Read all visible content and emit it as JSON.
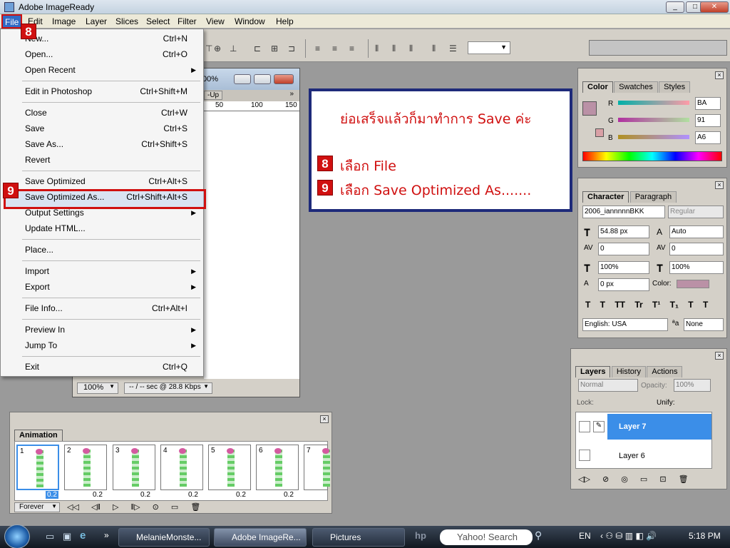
{
  "app_title": "Adobe ImageReady",
  "window_buttons": [
    "_",
    "□",
    "✕"
  ],
  "menubar": [
    "File",
    "Edit",
    "Image",
    "Layer",
    "Slices",
    "Select",
    "Filter",
    "View",
    "Window",
    "Help"
  ],
  "file_menu": {
    "new": {
      "label": "New...",
      "shortcut": "Ctrl+N"
    },
    "open": {
      "label": "Open...",
      "shortcut": "Ctrl+O"
    },
    "open_recent": {
      "label": "Open Recent"
    },
    "edit_photoshop": {
      "label": "Edit in Photoshop",
      "shortcut": "Ctrl+Shift+M"
    },
    "close": {
      "label": "Close",
      "shortcut": "Ctrl+W"
    },
    "save": {
      "label": "Save",
      "shortcut": "Ctrl+S"
    },
    "save_as": {
      "label": "Save As...",
      "shortcut": "Ctrl+Shift+S"
    },
    "revert": {
      "label": "Revert"
    },
    "save_optimized": {
      "label": "Save Optimized",
      "shortcut": "Ctrl+Alt+S"
    },
    "save_optimized_as": {
      "label": "Save Optimized As...",
      "shortcut": "Ctrl+Shift+Alt+S"
    },
    "output_settings": {
      "label": "Output Settings"
    },
    "update_html": {
      "label": "Update HTML..."
    },
    "place": {
      "label": "Place..."
    },
    "import": {
      "label": "Import"
    },
    "export": {
      "label": "Export"
    },
    "file_info": {
      "label": "File Info...",
      "shortcut": "Ctrl+Alt+I"
    },
    "preview_in": {
      "label": "Preview In"
    },
    "jump_to": {
      "label": "Jump To"
    },
    "exit": {
      "label": "Exit",
      "shortcut": "Ctrl+Q"
    }
  },
  "badges": {
    "step8": "8",
    "step9": "9"
  },
  "instruction": {
    "line1": "ย่อเสร็จแล้วก็มาทำการ  Save  ค่ะ",
    "line2": "เลือก  File",
    "line3": "เลือก  Save  Optimized  As......."
  },
  "document": {
    "title_fragment": "00%",
    "tab_fragment": "-Up",
    "ruler": [
      "50",
      "100",
      "150"
    ],
    "zoom": "100%",
    "status": "-- / -- sec @ 28.8 Kbps"
  },
  "color_panel": {
    "tabs": [
      "Color",
      "Swatches",
      "Styles"
    ],
    "channels": [
      {
        "name": "R",
        "value": "BA"
      },
      {
        "name": "G",
        "value": "91"
      },
      {
        "name": "B",
        "value": "A6"
      }
    ],
    "swatch": "#BA91A6"
  },
  "character_panel": {
    "tabs": [
      "Character",
      "Paragraph"
    ],
    "font": "2006_iannnnnBKK",
    "style": "Regular",
    "size": "54.88 px",
    "leading": "Auto",
    "tracking": "0",
    "kerning": "0",
    "vscale": "100%",
    "hscale": "100%",
    "baseline": "0 px",
    "color_label": "Color:",
    "language": "English: USA",
    "aa": "None"
  },
  "layers_panel": {
    "tabs": [
      "Layers",
      "History",
      "Actions"
    ],
    "blend": "Normal",
    "opacity_label": "Opacity:",
    "opacity": "100%",
    "lock_label": "Lock:",
    "unify_label": "Unify:",
    "layers": [
      "Layer 7",
      "Layer 6"
    ]
  },
  "animation_panel": {
    "tab": "Animation",
    "frames": [
      "1",
      "2",
      "3",
      "4",
      "5",
      "6",
      "7"
    ],
    "delay": "0.2",
    "loop": "Forever"
  },
  "taskbar": {
    "items": [
      "MelanieMonste...",
      "Adobe ImageRe...",
      "Pictures"
    ],
    "search": "Yahoo! Search",
    "lang": "EN",
    "time": "5:18 PM"
  }
}
